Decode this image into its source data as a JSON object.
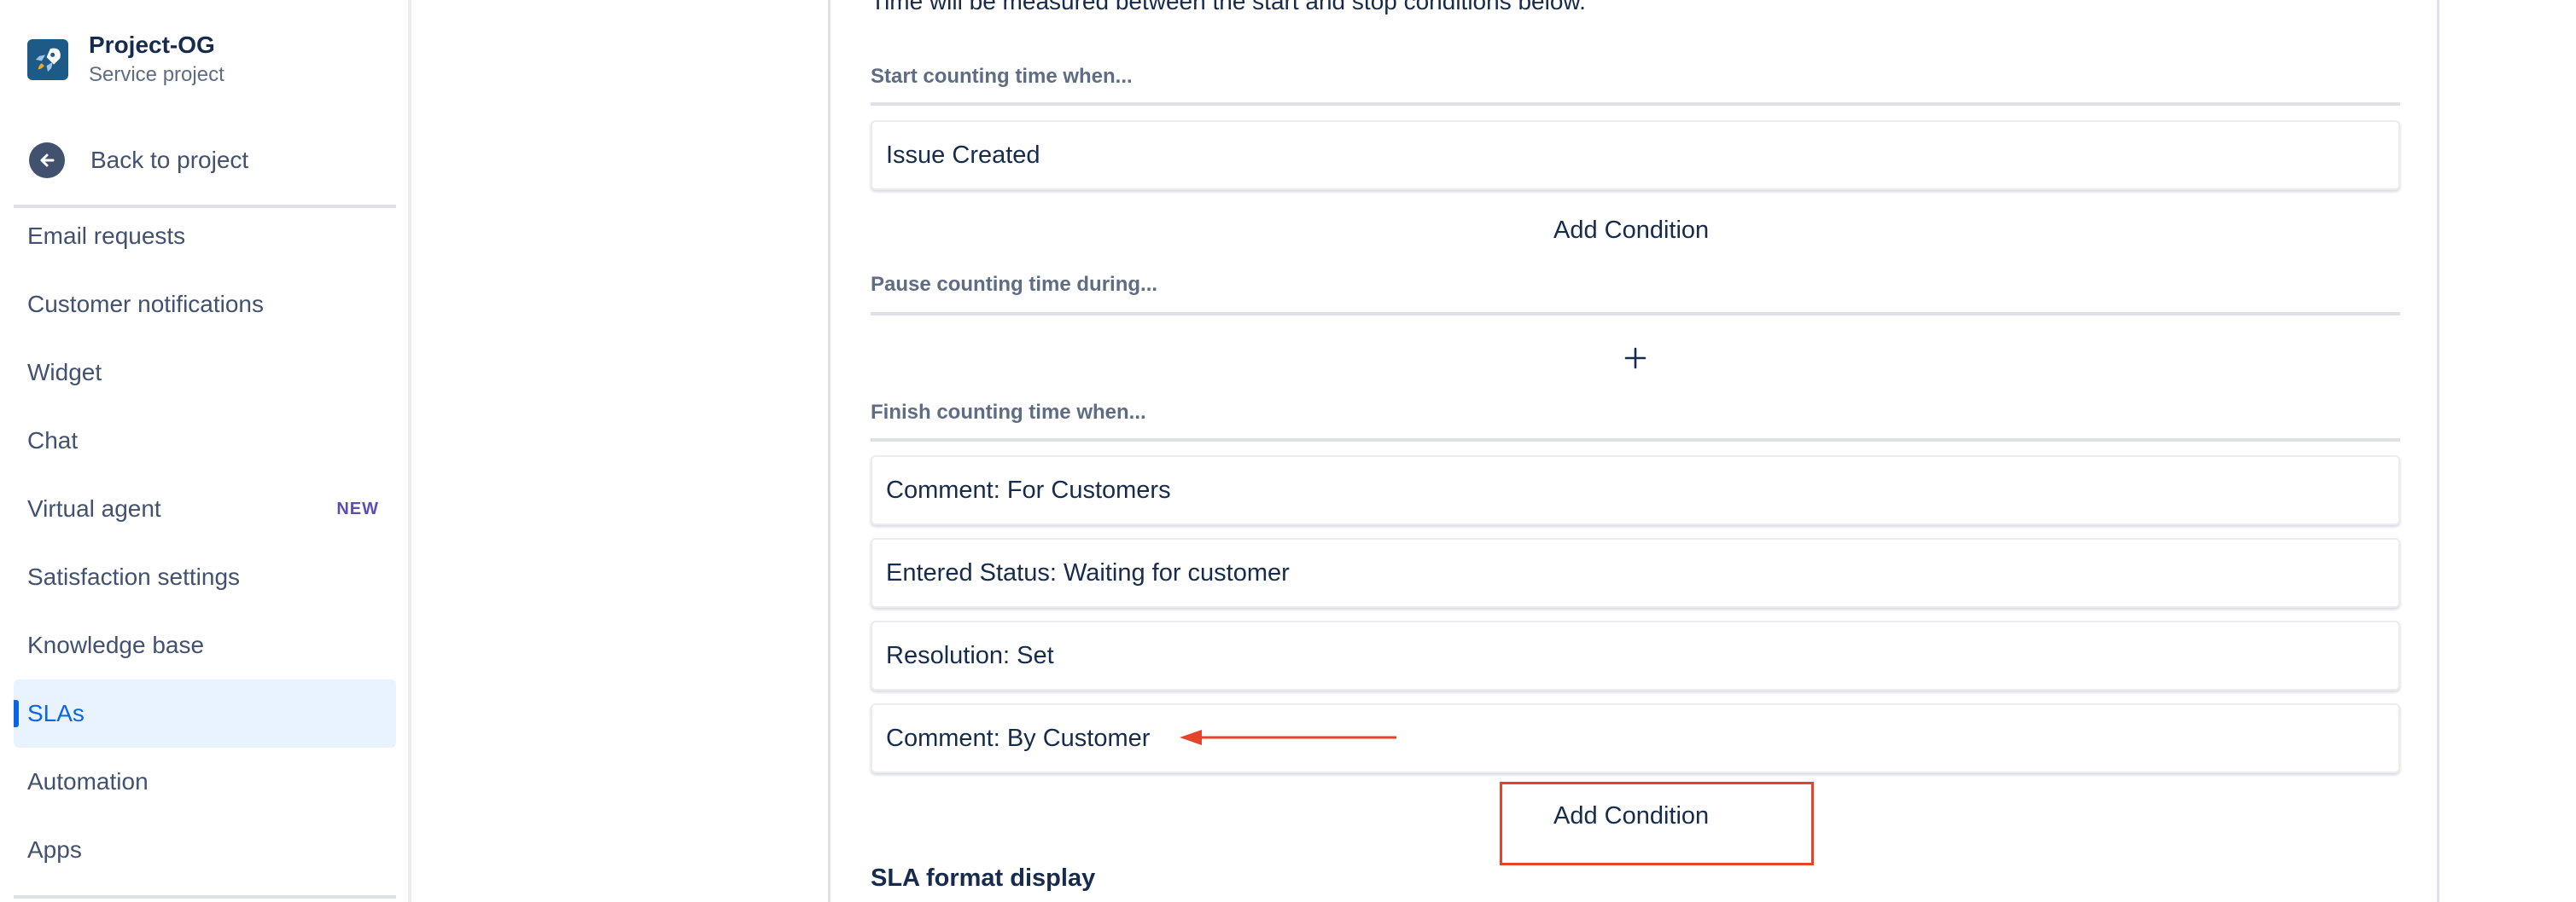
{
  "project": {
    "name": "Project-OG",
    "type": "Service project",
    "avatar_icon": "rocket-icon"
  },
  "sidebar": {
    "back_label": "Back to project",
    "items": [
      {
        "label": "Email requests"
      },
      {
        "label": "Customer notifications"
      },
      {
        "label": "Widget"
      },
      {
        "label": "Chat"
      },
      {
        "label": "Virtual agent",
        "badge": "NEW"
      },
      {
        "label": "Satisfaction settings"
      },
      {
        "label": "Knowledge base"
      },
      {
        "label": "SLAs",
        "active": true
      },
      {
        "label": "Automation"
      },
      {
        "label": "Apps"
      }
    ]
  },
  "main": {
    "intro": "Time will be measured between the start and stop conditions below.",
    "start": {
      "label": "Start counting time when...",
      "conditions": [
        "Issue Created"
      ],
      "add_label": "Add Condition"
    },
    "pause": {
      "label": "Pause counting time during...",
      "add_icon": "plus-icon"
    },
    "finish": {
      "label": "Finish counting time when...",
      "conditions": [
        "Comment: For Customers",
        "Entered Status: Waiting for customer",
        "Resolution: Set",
        "Comment: By Customer"
      ],
      "add_label": "Add Condition"
    },
    "sla_format_title": "SLA format display"
  },
  "annotation": {
    "color": "#e5432a",
    "arrow_target": "Comment: By Customer",
    "highlight_target": "Add Condition"
  },
  "colors": {
    "accent": "#0c66e4",
    "active_bg": "#e9f2ff",
    "badge": "#5e4db2",
    "text": "#172b4d",
    "subtle": "#5e6c84"
  }
}
